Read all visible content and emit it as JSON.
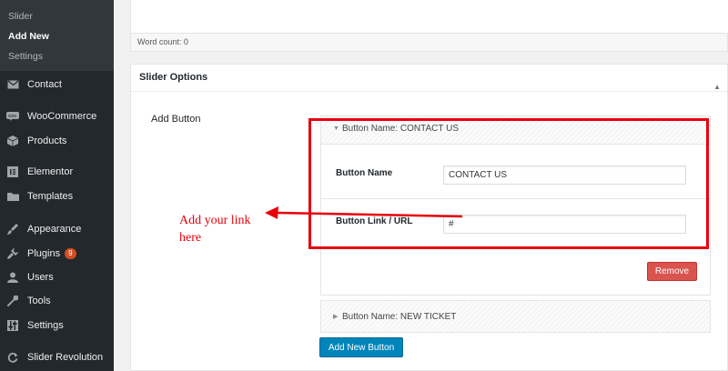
{
  "sidebar": {
    "submenu": [
      "Slider",
      "Add New",
      "Settings"
    ],
    "items": [
      {
        "label": "Contact",
        "icon": "mail-icon"
      },
      {
        "label": "WooCommerce",
        "icon": "woocommerce-icon"
      },
      {
        "label": "Products",
        "icon": "box-icon"
      },
      {
        "label": "Elementor",
        "icon": "elementor-icon"
      },
      {
        "label": "Templates",
        "icon": "folder-icon"
      },
      {
        "label": "Appearance",
        "icon": "brush-icon"
      },
      {
        "label": "Plugins",
        "icon": "plug-icon",
        "badge": "9"
      },
      {
        "label": "Users",
        "icon": "user-icon"
      },
      {
        "label": "Tools",
        "icon": "wrench-icon"
      },
      {
        "label": "Settings",
        "icon": "settings-icon"
      },
      {
        "label": "Slider Revolution",
        "icon": "refresh-icon"
      }
    ]
  },
  "editor": {
    "word_count": "Word count: 0"
  },
  "slider_options": {
    "title": "Slider Options",
    "add_button_label": "Add Button",
    "button1": {
      "header": "Button Name: CONTACT US",
      "name_label": "Button Name",
      "name_value": "CONTACT US",
      "link_label": "Button Link / URL",
      "link_value": "#",
      "remove_label": "Remove"
    },
    "button2": {
      "header": "Button Name: NEW TICKET"
    },
    "add_new_label": "Add New Button"
  },
  "annotation": {
    "line1": "Add your link",
    "line2": "here",
    "color": "#e8000c"
  },
  "colors": {
    "sidebar_bg": "#23282d",
    "primary_button": "#0085ba",
    "remove_button": "#d9534f"
  }
}
